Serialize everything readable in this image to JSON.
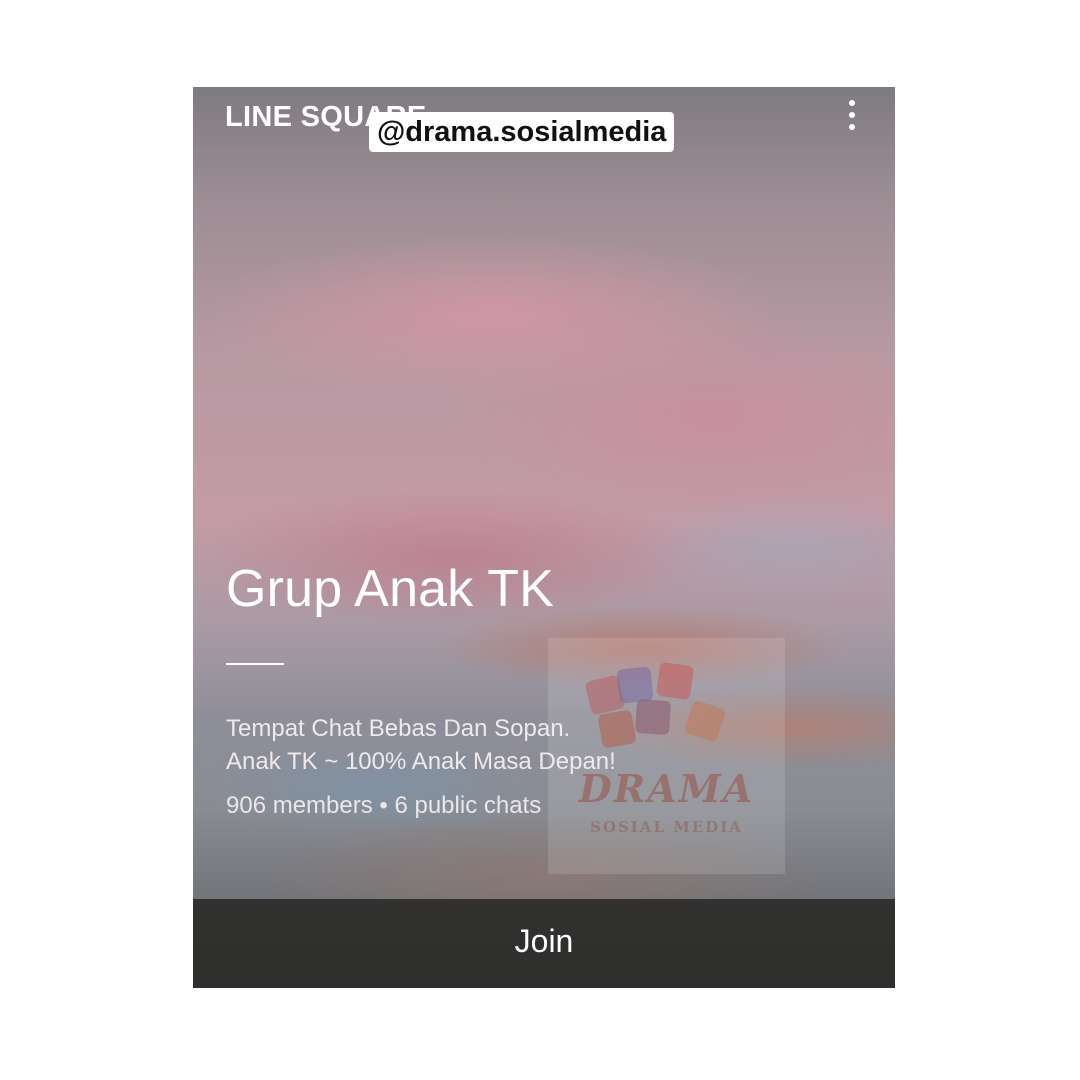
{
  "app": {
    "title": "LINE SQUARE"
  },
  "group": {
    "name": "Grup Anak TK",
    "description_line1": "Tempat Chat Bebas Dan Sopan.",
    "description_line2": "Anak TK ~ 100% Anak Masa Depan!",
    "stats": "906 members • 6 public chats"
  },
  "actions": {
    "join_label": "Join"
  },
  "overlay": {
    "handle": "@drama.sosialmedia",
    "logo_text": "DRAMA",
    "logo_subtext": "SOSIAL MEDIA"
  },
  "icons": {
    "menu": "more-vertical-icon"
  },
  "colors": {
    "join_bar": "#2a2a28",
    "text": "#ffffff"
  }
}
